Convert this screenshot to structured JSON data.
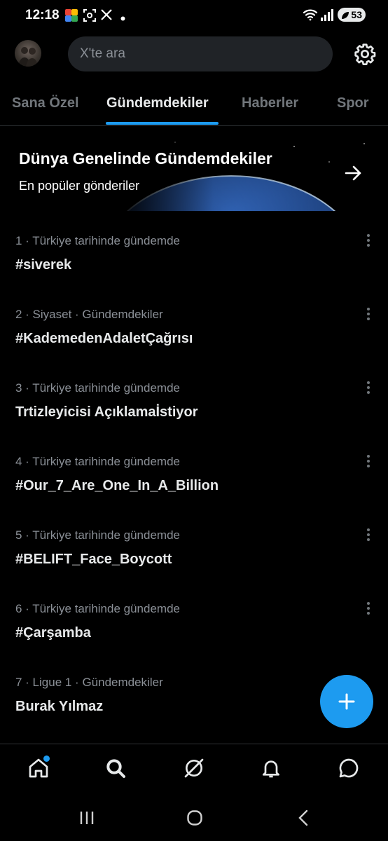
{
  "status_bar": {
    "time": "12:18",
    "battery": "53",
    "icons": [
      "photos-app-icon",
      "screen-capture-icon",
      "x-app-icon",
      "dot-icon",
      "wifi-icon",
      "signal-icon",
      "battery-saver-icon"
    ]
  },
  "header": {
    "search_placeholder": "X'te ara",
    "avatar_icon": "user-avatar",
    "settings_icon": "gear-icon"
  },
  "tabs": [
    {
      "label": "Sana Özel",
      "active": false
    },
    {
      "label": "Gündemdekiler",
      "active": true
    },
    {
      "label": "Haberler",
      "active": false
    },
    {
      "label": "Spor",
      "active": false
    }
  ],
  "banner": {
    "title": "Dünya Genelinde Gündemdekiler",
    "subtitle": "En popüler gönderiler",
    "icon": "arrow-right-icon"
  },
  "trends": [
    {
      "meta": "1 · Türkiye tarihinde gündemde",
      "name": "#siverek"
    },
    {
      "meta": "2 · Siyaset · Gündemdekiler",
      "name": "#KademedenAdaletÇağrısı"
    },
    {
      "meta": "3 · Türkiye tarihinde gündemde",
      "name": "Trtizleyicisi Açıklamaİstiyor"
    },
    {
      "meta": "4 · Türkiye tarihinde gündemde",
      "name": "#Our_7_Are_One_In_A_Billion"
    },
    {
      "meta": "5 · Türkiye tarihinde gündemde",
      "name": "#BELIFT_Face_Boycott"
    },
    {
      "meta": "6 · Türkiye tarihinde gündemde",
      "name": "#Çarşamba"
    },
    {
      "meta": "7 · Ligue 1 · Gündemdekiler",
      "name": "Burak Yılmaz"
    }
  ],
  "fab": {
    "icon": "plus-icon"
  },
  "bottom_nav": [
    {
      "name": "home",
      "icon": "home-icon",
      "has_badge": true
    },
    {
      "name": "explore",
      "icon": "search-icon",
      "active": true
    },
    {
      "name": "grok",
      "icon": "grok-icon"
    },
    {
      "name": "notifications",
      "icon": "bell-icon"
    },
    {
      "name": "messages",
      "icon": "message-icon"
    }
  ],
  "system_nav": [
    "recents-icon",
    "home-circle-icon",
    "back-icon"
  ],
  "colors": {
    "background": "#000000",
    "accent": "#1d9bf0",
    "text_primary": "#e7e9ea",
    "text_secondary": "#8b9097",
    "search_bg": "#202327"
  }
}
